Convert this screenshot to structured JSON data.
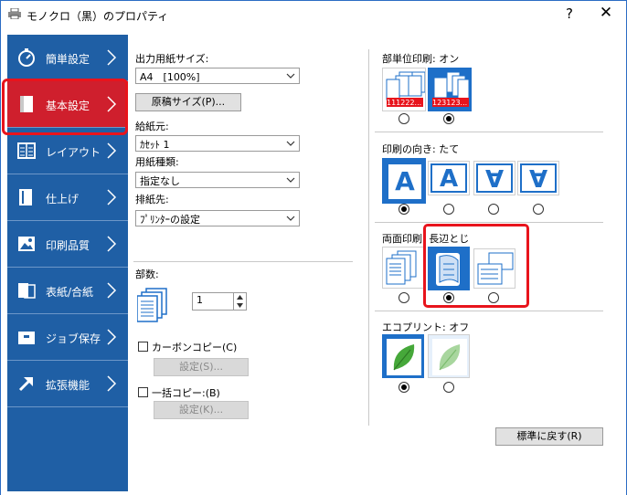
{
  "window": {
    "title": "モノクロ（黒）のプロパティ",
    "help": "?",
    "close": "✕"
  },
  "sidebar": {
    "items": [
      {
        "label": "簡単設定"
      },
      {
        "label": "基本設定"
      },
      {
        "label": "レイアウト"
      },
      {
        "label": "仕上げ"
      },
      {
        "label": "印刷品質"
      },
      {
        "label": "表紙/合紙"
      },
      {
        "label": "ジョブ保存"
      },
      {
        "label": "拡張機能"
      }
    ],
    "active_index": 1
  },
  "paper": {
    "output_size_label": "出力用紙サイズ:",
    "output_size_value": "A4　[100%]",
    "original_size_button": "原稿サイズ(P)...",
    "source_label": "給紙元:",
    "source_value": "ｶｾｯﾄ 1",
    "media_type_label": "用紙種類:",
    "media_type_value": "指定なし",
    "output_dest_label": "排紙先:",
    "output_dest_value": "ﾌﾟﾘﾝﾀｰの設定"
  },
  "copies": {
    "label": "部数:",
    "value": "1",
    "carbon_label": "カーボンコピー(C)",
    "carbon_button": "設定(S)...",
    "batch_label": "一括コピー:(B)",
    "batch_button": "設定(K)..."
  },
  "collate": {
    "label": "部単位印刷: オン",
    "off_text": "111222...",
    "on_text": "123123...",
    "selected": 1
  },
  "orientation": {
    "label": "印刷の向き: たて",
    "glyph": "A",
    "selected": 0
  },
  "duplex": {
    "label": "両面印刷: 長辺とじ",
    "selected": 1
  },
  "ecoprint": {
    "label": "エコプリント: オフ",
    "selected": 0
  },
  "reset_button": "標準に戻す(R)",
  "colors": {
    "sidebar": "#1f5fa5",
    "active": "#cf1f2d",
    "accent": "#1e6fc8",
    "highlight": "#e8141c"
  }
}
